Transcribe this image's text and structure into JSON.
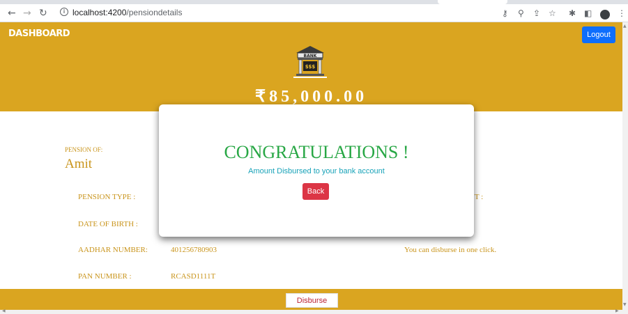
{
  "browser": {
    "url_host": "localhost:4200",
    "url_path": "/pensiondetails",
    "icons": [
      "back-icon",
      "forward-icon",
      "reload-icon",
      "key-icon",
      "zoom-icon",
      "share-icon",
      "bookmark-star-icon",
      "extensions-icon",
      "sidepanel-icon",
      "profile-avatar",
      "menu-icon"
    ]
  },
  "header": {
    "brand": "DASHBOARD",
    "logout_label": "Logout",
    "bank_sign": "BANK",
    "bank_money": "$$$",
    "amount": "₹85,000.00"
  },
  "details": {
    "pension_of_label": "PENSION OF:",
    "name": "Amit",
    "rows": [
      {
        "label": "PENSION TYPE :",
        "value": ""
      },
      {
        "label": "DATE OF BIRTH :",
        "value": ""
      },
      {
        "label": "AADHAR NUMBER:",
        "value": "401256780903"
      },
      {
        "label": "PAN NUMBER :",
        "value": "RCASD1111T"
      }
    ],
    "partial_label": "UNT :",
    "info_message": "You can disburse in one click."
  },
  "footer": {
    "disburse_label": "Disburse"
  },
  "modal": {
    "title": "CONGRATULATIONS !",
    "message": "Amount Disbursed to your bank account",
    "back_label": "Back"
  },
  "colors": {
    "header_bg": "#daa520",
    "logout_bg": "#0d6efd",
    "title_green": "#28a745",
    "message_teal": "#17a2b8",
    "back_red": "#dc3545",
    "label_gold": "#c9941b"
  }
}
